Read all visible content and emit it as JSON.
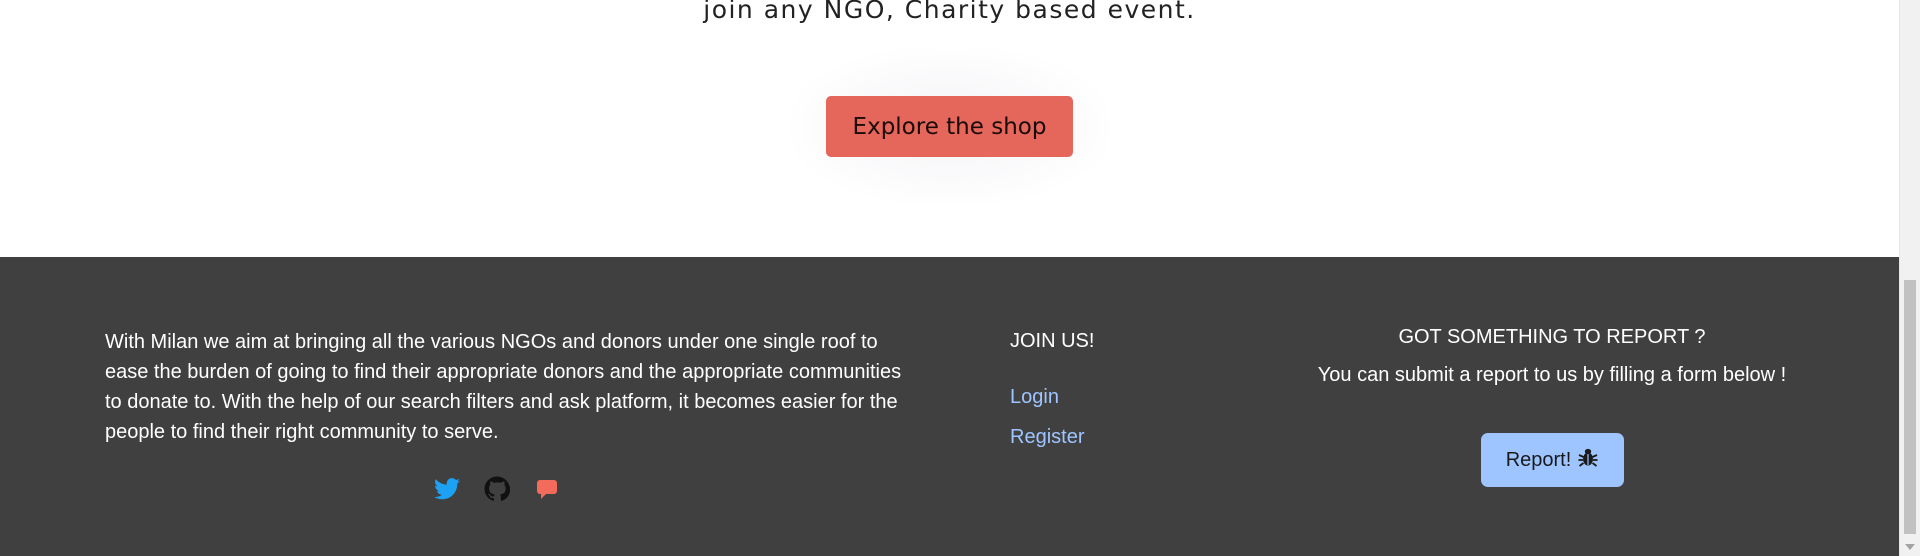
{
  "hero": {
    "tagline": "join any NGO, Charity based event.",
    "cta_label": "Explore the shop"
  },
  "footer": {
    "about": "With Milan we aim at bringing all the various NGOs and donors under one single roof to ease the burden of going to find their appropriate donors and the appropriate communities to donate to. With the help of our search filters and ask platform, it becomes easier for the people to find their right community to serve.",
    "socials": [
      {
        "icon": "twitter-icon",
        "color": "#1da1f2"
      },
      {
        "icon": "github-icon",
        "color": "#111111"
      },
      {
        "icon": "chat-icon",
        "color": "#f26b5b"
      }
    ],
    "join": {
      "title": "JOIN US!",
      "links": [
        "Login",
        "Register"
      ]
    },
    "report": {
      "title": "GOT SOMETHING TO REPORT ?",
      "subtitle": "You can submit a report to us by filling a form below !",
      "button_label": "Report!",
      "button_icon": "bug-icon"
    }
  },
  "colors": {
    "cta_bg": "#e5665a",
    "footer_bg": "#404040",
    "link": "#9ec5ff",
    "report_button_bg": "#9ec5ff"
  }
}
